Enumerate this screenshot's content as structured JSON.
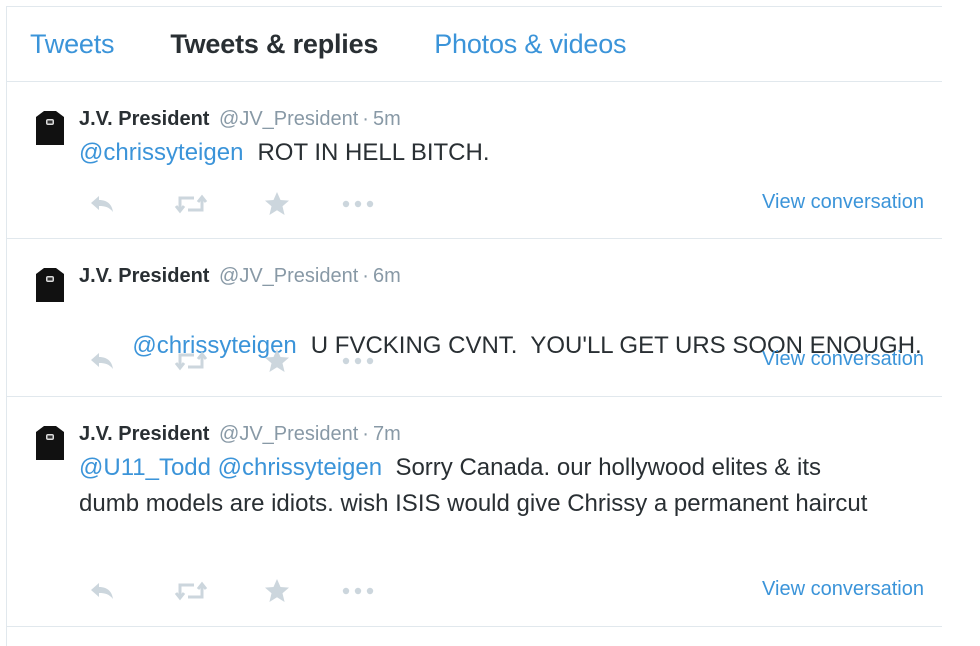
{
  "tabs": [
    {
      "label": "Tweets",
      "active": false
    },
    {
      "label": "Tweets & replies",
      "active": true
    },
    {
      "label": "Photos & videos",
      "active": false
    }
  ],
  "icons": {
    "avatar": "avatar-shirt-icon",
    "reply": "reply-icon",
    "retweet": "retweet-icon",
    "favorite": "star-icon",
    "more": "more-dots-icon"
  },
  "colors": {
    "link": "#3b94d9",
    "muted": "#8899a6",
    "icon": "#ccd6dd",
    "text": "#292f33"
  },
  "tweets": [
    {
      "name": "J.V. President",
      "handle": "@JV_President",
      "separator": "·",
      "time": "5m",
      "mentions": "@chrissyteigen",
      "text": "ROT IN HELL BITCH.",
      "view_conversation": "View conversation"
    },
    {
      "name": "J.V. President",
      "handle": "@JV_President",
      "separator": "·",
      "time": "6m",
      "mentions": "@chrissyteigen",
      "text": "U FVCKING CVNT.  YOU'LL GET URS SOON ENOUGH.",
      "view_conversation": "View conversation"
    },
    {
      "name": "J.V. President",
      "handle": "@JV_President",
      "separator": "·",
      "time": "7m",
      "mentions": "@U11_Todd @chrissyteigen",
      "text": "Sorry Canada. our hollywood elites & its dumb models are idiots. wish ISIS would give Chrissy a permanent haircut",
      "view_conversation": "View conversation"
    }
  ]
}
